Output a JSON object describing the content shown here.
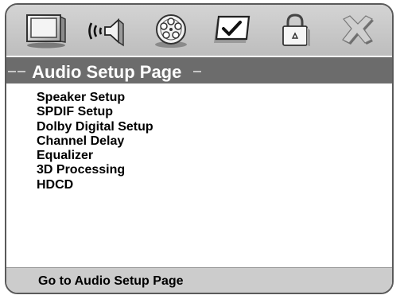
{
  "icon_bar": {
    "items": [
      {
        "icon": "tv-icon",
        "label": "General Setup"
      },
      {
        "icon": "speaker-icon",
        "label": "Audio Setup"
      },
      {
        "icon": "film-reel-icon",
        "label": "Video Setup"
      },
      {
        "icon": "checkmark-icon",
        "label": "Preference"
      },
      {
        "icon": "lock-icon",
        "label": "Password"
      },
      {
        "icon": "close-icon",
        "label": "Exit"
      }
    ],
    "selected_index": 1
  },
  "page": {
    "title": "Audio Setup Page"
  },
  "menu": {
    "items": [
      "Speaker Setup",
      "SPDIF Setup",
      "Dolby Digital Setup",
      "Channel Delay",
      "Equalizer",
      "3D Processing",
      "HDCD"
    ]
  },
  "status": {
    "text": "Go to Audio Setup Page"
  },
  "colors": {
    "icon_bar_bg": "#c8c8c8",
    "title_bar_bg": "#6c6c6c",
    "title_text": "#ffffff",
    "status_bar_bg": "#cccccc",
    "frame_border": "#5a5a5a"
  }
}
